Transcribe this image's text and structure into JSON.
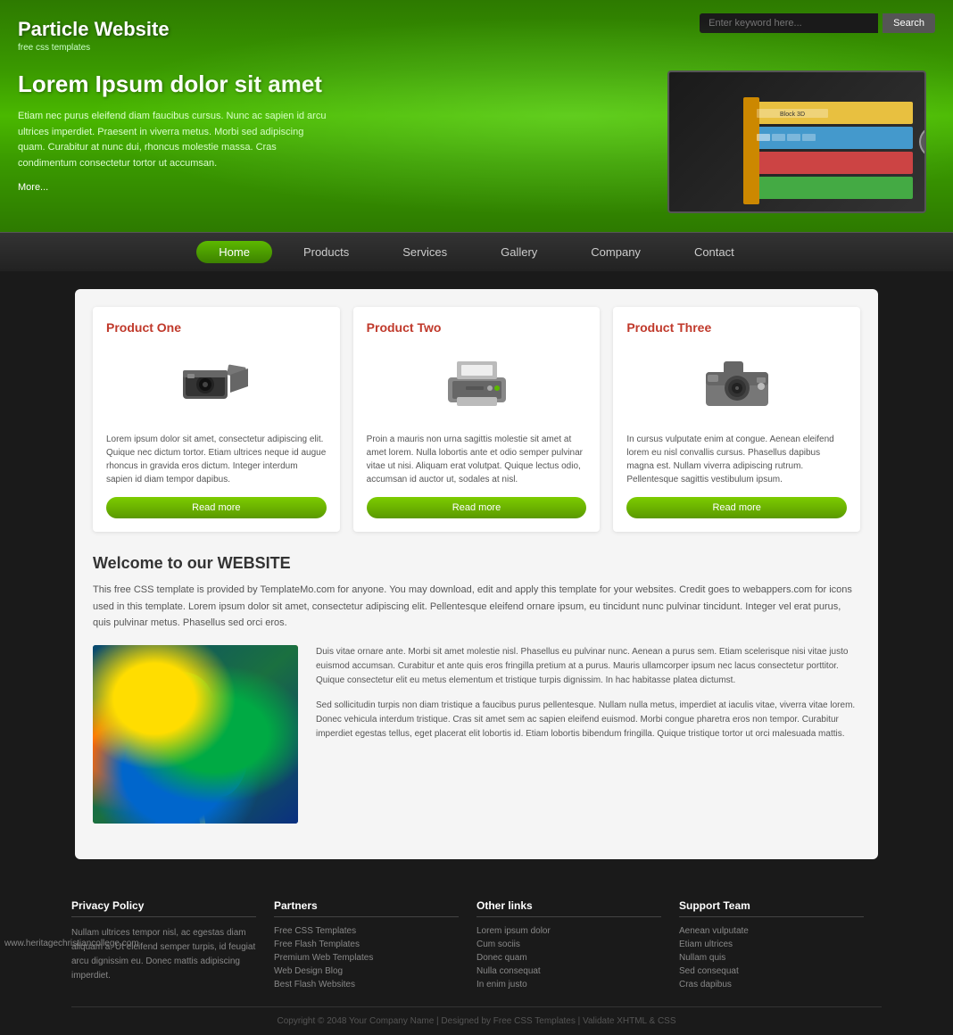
{
  "header": {
    "logo_title": "Particle Website",
    "logo_sub": "free css templates",
    "search_placeholder": "Enter keyword here...",
    "search_btn": "Search",
    "hero_title": "Lorem Ipsum dolor sit amet",
    "hero_desc": "Etiam nec purus eleifend diam faucibus cursus. Nunc ac sapien id arcu ultrices imperdiet. Praesent in viverra metus. Morbi sed adipiscing quam. Curabitur at nunc dui, rhoncus molestie massa. Cras condimentum consectetur tortor ut accumsan.",
    "hero_more": "More..."
  },
  "nav": {
    "items": [
      {
        "label": "Home",
        "active": true
      },
      {
        "label": "Products",
        "active": false
      },
      {
        "label": "Services",
        "active": false
      },
      {
        "label": "Gallery",
        "active": false
      },
      {
        "label": "Company",
        "active": false
      },
      {
        "label": "Contact",
        "active": false
      }
    ]
  },
  "products": [
    {
      "title": "Product One",
      "desc": "Lorem ipsum dolor sit amet, consectetur adipiscing elit. Quique nec dictum tortor. Etiam ultrices neque id augue rhoncus in gravida eros dictum. Integer interdum sapien id diam tempor dapibus.",
      "btn": "Read more"
    },
    {
      "title": "Product Two",
      "desc": "Proin a mauris non urna sagittis molestie sit amet at amet lorem. Nulla lobortis ante et odio semper pulvinar vitae ut nisi. Aliquam erat volutpat. Quique lectus odio, accumsan id auctor ut, sodales at nisl.",
      "btn": "Read more"
    },
    {
      "title": "Product Three",
      "desc": "In cursus vulputate enim at congue. Aenean eleifend lorem eu nisl convallis cursus. Phasellus dapibus magna est. Nullam viverra adipiscing rutrum. Pellentesque sagittis vestibulum ipsum.",
      "btn": "Read more"
    }
  ],
  "welcome": {
    "title": "Welcome to our WEBSITE",
    "intro": "This free CSS template is provided by TemplateMo.com for anyone. You may download, edit and apply this template for your websites. Credit goes to webappers.com for icons used in this template. Lorem ipsum dolor sit amet, consectetur adipiscing elit. Pellentesque eleifend ornare ipsum, eu tincidunt nunc pulvinar tincidunt. Integer vel erat purus, quis pulvinar metus. Phasellus sed orci eros.",
    "para1": "Duis vitae ornare ante. Morbi sit amet molestie nisl. Phasellus eu pulvinar nunc. Aenean a purus sem. Etiam scelerisque nisi vitae justo euismod accumsan. Curabitur et ante quis eros fringilla pretium at a purus. Mauris ullamcorper ipsum nec lacus consectetur porttitor. Quique consectetur elit eu metus elementum et tristique turpis dignissim. In hac habitasse platea dictumst.",
    "para2": "Sed sollicitudin turpis non diam tristique a faucibus purus pellentesque. Nullam nulla metus, imperdiet at iaculis vitae, viverra vitae lorem. Donec vehicula interdum tristique. Cras sit amet sem ac sapien eleifend euismod. Morbi congue pharetra eros non tempor. Curabitur imperdiet egestas tellus, eget placerat elit lobortis id. Etiam lobortis bibendum fringilla. Quique tristique tortor ut orci malesuada mattis."
  },
  "footer": {
    "cols": [
      {
        "title": "Privacy Policy",
        "text": "Nullam ultrices tempor nisl, ac egestas diam aliquam a. Ut eleifend semper turpis, id feugiat arcu dignissim eu. Donec mattis adipiscing imperdiet."
      },
      {
        "title": "Partners",
        "links": [
          "Free CSS Templates",
          "Free Flash Templates",
          "Premium Web Templates",
          "Web Design Blog",
          "Best Flash Websites"
        ]
      },
      {
        "title": "Other links",
        "links": [
          "Lorem ipsum dolor",
          "Cum sociis",
          "Donec quam",
          "Nulla consequat",
          "In enim justo"
        ]
      },
      {
        "title": "Support Team",
        "links": [
          "Aenean vulputate",
          "Etiam ultrices",
          "Nullam quis",
          "Sed consequat",
          "Cras dapibus"
        ]
      }
    ],
    "copyright": "Copyright © 2048 Your Company Name | Designed by Free CSS Templates | Validate XHTML & CSS"
  },
  "watermark": "www.heritagechristiancollege.com"
}
